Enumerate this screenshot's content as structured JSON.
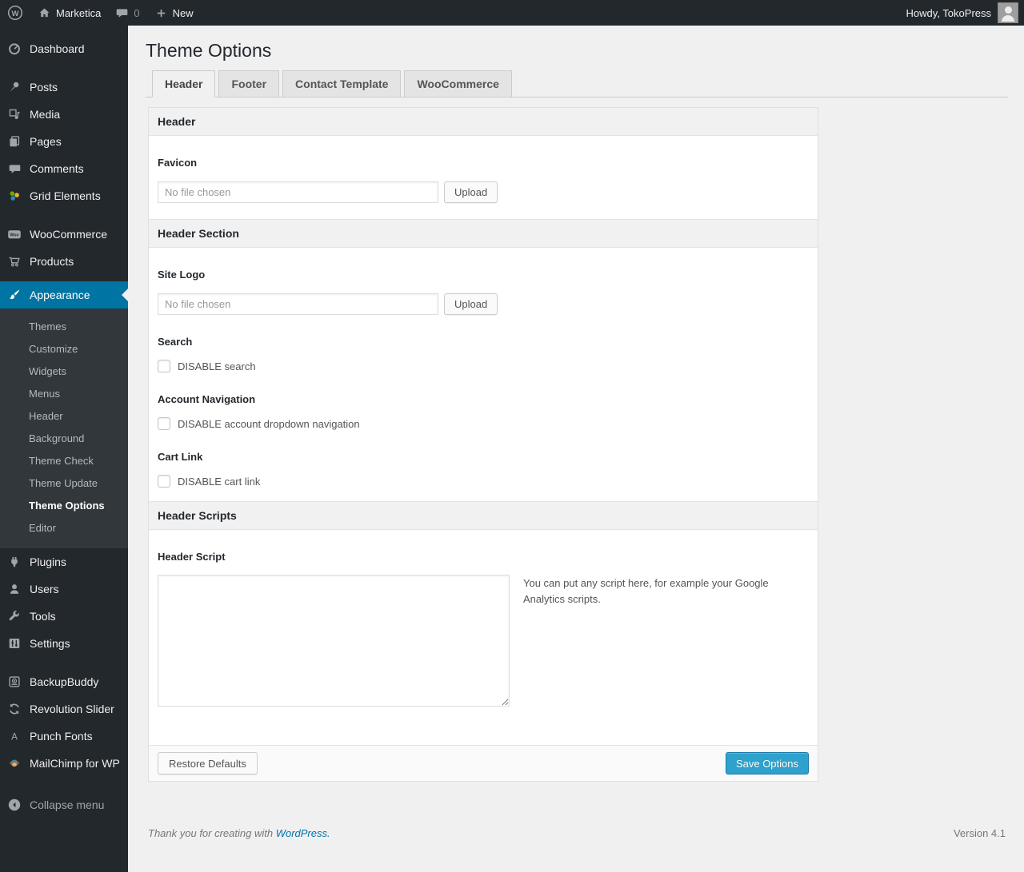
{
  "colors": {
    "accent": "#0074a2",
    "primary_button": "#2ea2cc",
    "admin_bar_bg": "#23282d",
    "content_bg": "#f0f0f1"
  },
  "admin_bar": {
    "site_name": "Marketica",
    "comment_count": "0",
    "new_label": "New",
    "howdy": "Howdy, TokoPress"
  },
  "sidebar": {
    "items": [
      {
        "label": "Dashboard",
        "icon": "dashboard-icon"
      },
      {
        "label": "Posts",
        "icon": "pin-icon"
      },
      {
        "label": "Media",
        "icon": "media-icon"
      },
      {
        "label": "Pages",
        "icon": "pages-icon"
      },
      {
        "label": "Comments",
        "icon": "comments-icon"
      },
      {
        "label": "Grid Elements",
        "icon": "grid-elements-icon"
      },
      {
        "label": "WooCommerce",
        "icon": "woocommerce-icon"
      },
      {
        "label": "Products",
        "icon": "cart-icon"
      },
      {
        "label": "Appearance",
        "icon": "brush-icon",
        "active": true
      },
      {
        "label": "Plugins",
        "icon": "plug-icon"
      },
      {
        "label": "Users",
        "icon": "user-icon"
      },
      {
        "label": "Tools",
        "icon": "wrench-icon"
      },
      {
        "label": "Settings",
        "icon": "settings-icon"
      },
      {
        "label": "BackupBuddy",
        "icon": "backup-icon"
      },
      {
        "label": "Revolution Slider",
        "icon": "rotate-icon"
      },
      {
        "label": "Punch Fonts",
        "icon": "letter-a-icon"
      },
      {
        "label": "MailChimp for WP",
        "icon": "monkey-icon"
      }
    ],
    "appearance_submenu": [
      {
        "label": "Themes"
      },
      {
        "label": "Customize"
      },
      {
        "label": "Widgets"
      },
      {
        "label": "Menus"
      },
      {
        "label": "Header"
      },
      {
        "label": "Background"
      },
      {
        "label": "Theme Check"
      },
      {
        "label": "Theme Update"
      },
      {
        "label": "Theme Options",
        "current": true
      },
      {
        "label": "Editor"
      }
    ],
    "collapse_label": "Collapse menu"
  },
  "page": {
    "title": "Theme Options",
    "tabs": [
      {
        "label": "Header",
        "active": true
      },
      {
        "label": "Footer",
        "active": false
      },
      {
        "label": "Contact Template",
        "active": false
      },
      {
        "label": "WooCommerce",
        "active": false
      }
    ]
  },
  "panel": {
    "section_header": "Header",
    "favicon": {
      "label": "Favicon",
      "file_placeholder": "No file chosen",
      "file_value": "",
      "upload_label": "Upload"
    },
    "section_header_section": "Header Section",
    "site_logo": {
      "label": "Site Logo",
      "file_placeholder": "No file chosen",
      "file_value": "",
      "upload_label": "Upload"
    },
    "search": {
      "label": "Search",
      "checkbox_label": "DISABLE search",
      "checked": false
    },
    "account_navigation": {
      "label": "Account Navigation",
      "checkbox_label": "DISABLE account dropdown navigation",
      "checked": false
    },
    "cart_link": {
      "label": "Cart Link",
      "checkbox_label": "DISABLE cart link",
      "checked": false
    },
    "section_header_scripts": "Header Scripts",
    "header_script": {
      "label": "Header Script",
      "textarea_value": "",
      "help_text": "You can put any script here, for example your Google Analytics scripts."
    },
    "footer": {
      "restore_label": "Restore Defaults",
      "save_label": "Save Options"
    }
  },
  "page_footer": {
    "thanks_text": "Thank you for creating with ",
    "link_label": "WordPress.",
    "version": "Version 4.1"
  }
}
